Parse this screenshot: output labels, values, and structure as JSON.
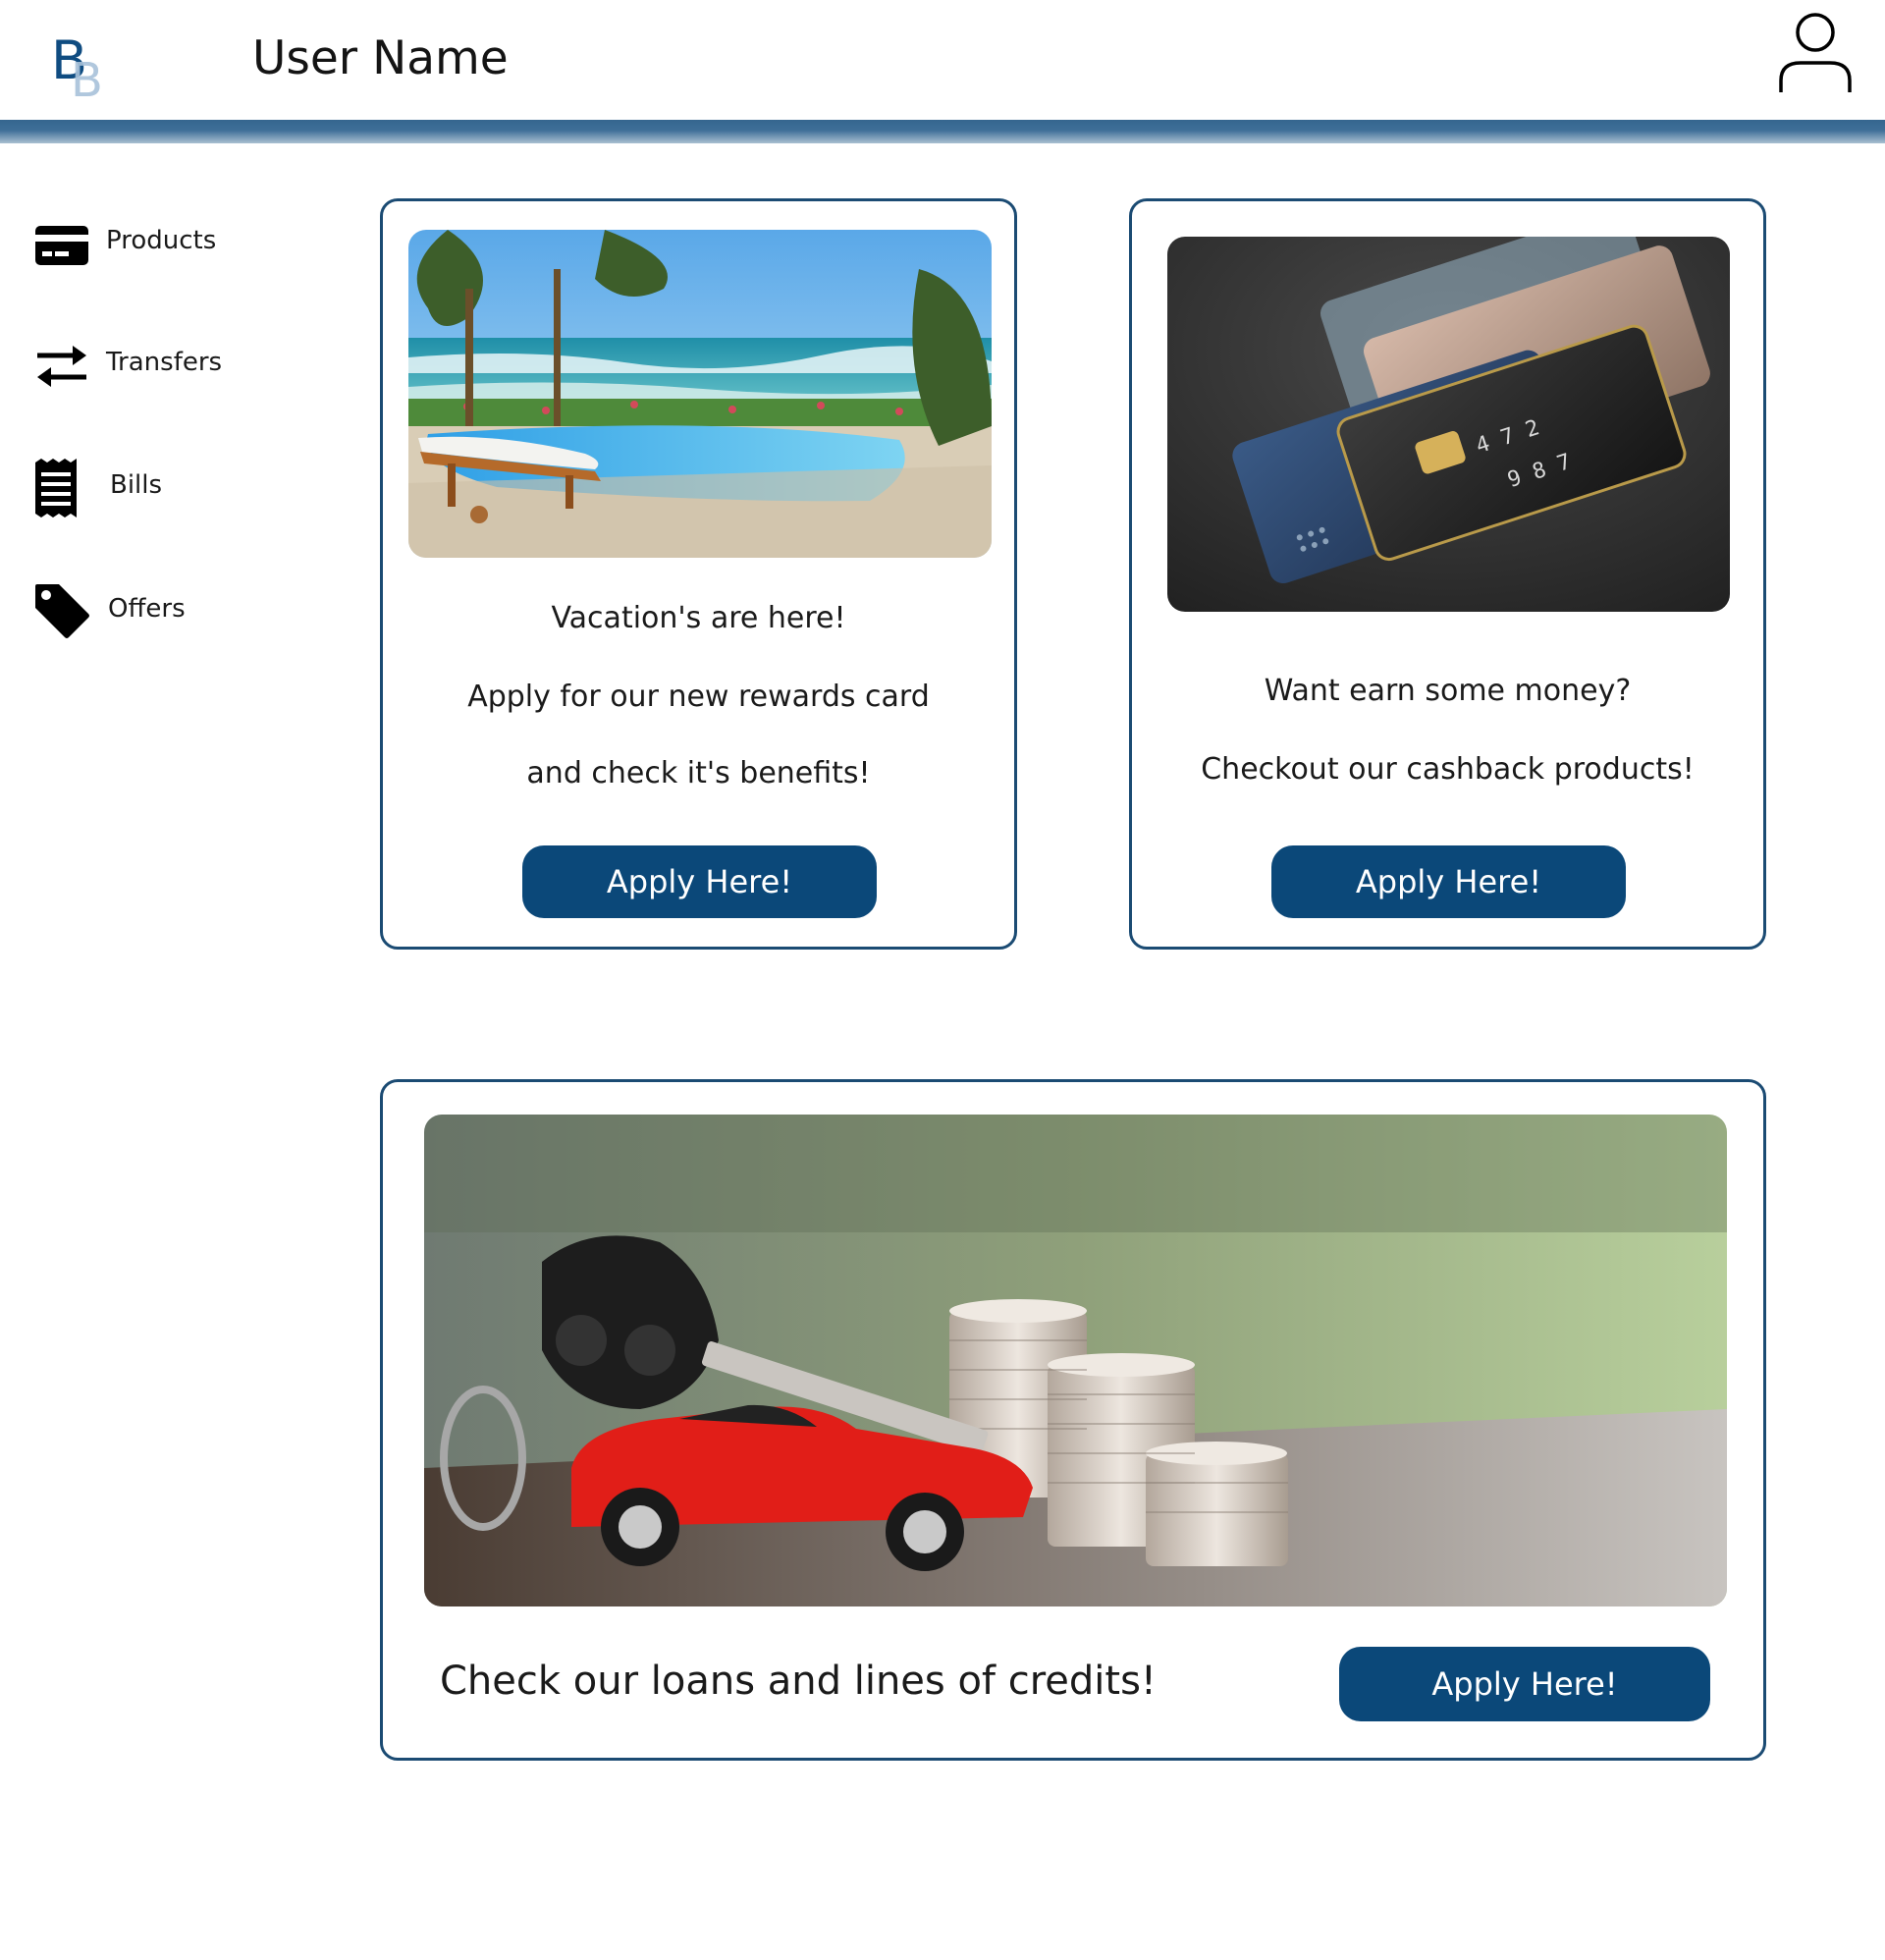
{
  "header": {
    "logo_alt": "BB",
    "user_name": "User Name",
    "profile_icon": "user-icon",
    "accent_color": "#3a6a93"
  },
  "sidebar": {
    "items": [
      {
        "label": "Products",
        "icon": "credit-card-icon"
      },
      {
        "label": "Transfers",
        "icon": "transfer-arrows-icon"
      },
      {
        "label": "Bills",
        "icon": "receipt-icon"
      },
      {
        "label": "Offers",
        "icon": "tag-icon"
      }
    ]
  },
  "cards": {
    "vacation": {
      "image": "beach-pool-photo",
      "line1": "Vacation's are here!",
      "line2": "Apply for our new rewards card",
      "line3": "and check it's benefits!",
      "button": "Apply Here!"
    },
    "cashback": {
      "image": "credit-cards-photo",
      "line1": "Want earn some money?",
      "line2": "Checkout our cashback products!",
      "button": "Apply Here!"
    },
    "loans": {
      "image": "car-keys-coins-photo",
      "text": "Check our loans and lines of credits!",
      "button": "Apply Here!"
    }
  },
  "colors": {
    "button": "#0b4879",
    "card_border": "#1b4b73",
    "header_bar": "#3a6a93"
  }
}
